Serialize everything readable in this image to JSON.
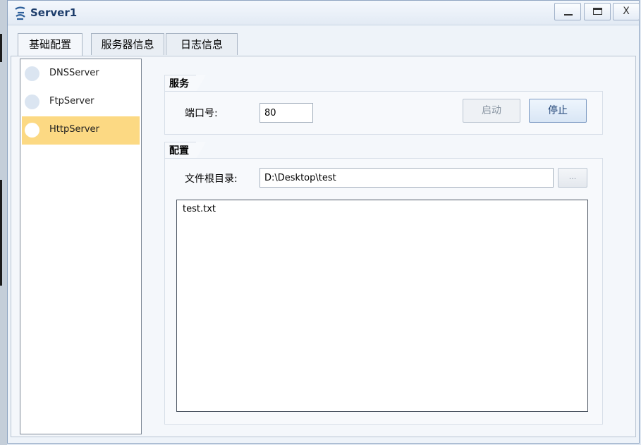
{
  "window": {
    "title": "Server1",
    "controls": [
      "_",
      "□",
      "X"
    ]
  },
  "tabs": [
    "基础配置",
    "服务器信息",
    "日志信息"
  ],
  "sidebar": {
    "items": [
      {
        "label": "DNSServer"
      },
      {
        "label": "FtpServer"
      },
      {
        "label": "HttpServer"
      }
    ],
    "selected": "HttpServer"
  },
  "service_group": {
    "title": "服务",
    "port_label": "端口号:",
    "port_value": "80",
    "start_label": "启动",
    "stop_label": "停止"
  },
  "config_group": {
    "title": "配置",
    "root_label": "文件根目录:",
    "root_value": "D:\\Desktop\\test",
    "browse_label": "...",
    "files": [
      "test.txt"
    ]
  },
  "colors": {
    "selected_item": "#fcd983",
    "title_text": "#1d3d6b",
    "window_bg": "#eef3f9"
  },
  "icons": {
    "app": "server-app-icon",
    "minimize": "minimize-icon",
    "maximize": "maximize-icon",
    "close": "close-icon"
  }
}
